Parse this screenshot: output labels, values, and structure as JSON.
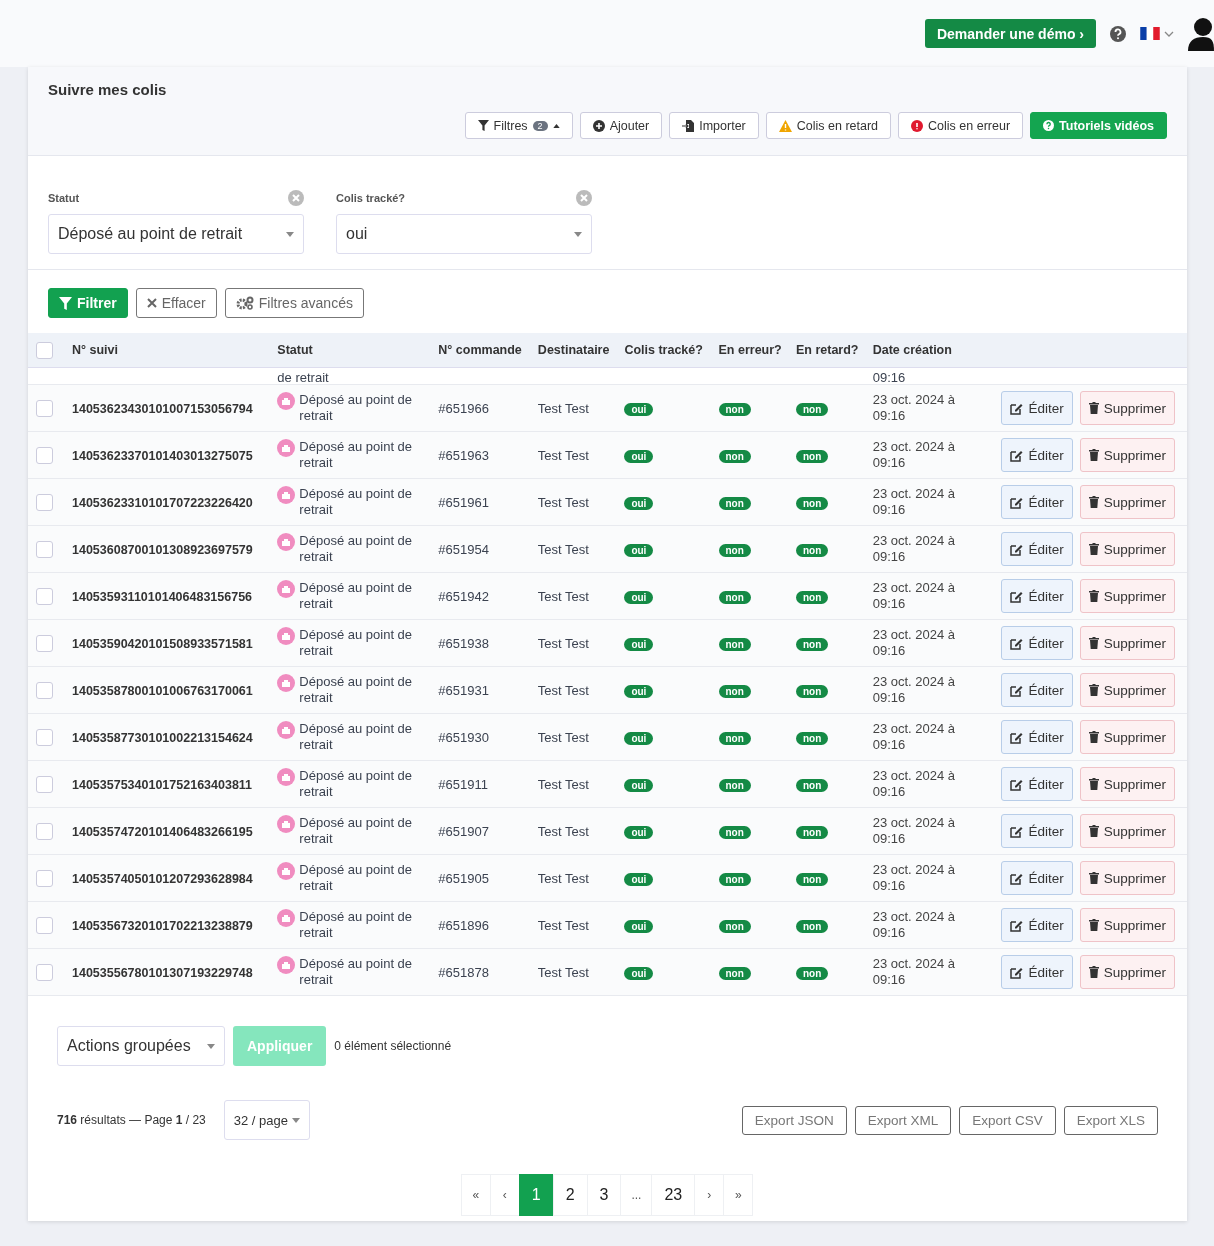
{
  "header": {
    "demo_button": "Demander une démo ›"
  },
  "page": {
    "title": "Suivre mes colis"
  },
  "toolbar": [
    {
      "kind": "filter",
      "label": "Filtres",
      "badge": "2"
    },
    {
      "kind": "add",
      "label": "Ajouter"
    },
    {
      "kind": "import",
      "label": "Importer"
    },
    {
      "kind": "warning",
      "label": "Colis en retard"
    },
    {
      "kind": "error",
      "label": "Colis en erreur"
    },
    {
      "kind": "video",
      "label": "Tutoriels vidéos"
    }
  ],
  "filters": [
    {
      "label": "Statut",
      "value": "Déposé au point de retrait"
    },
    {
      "label": "Colis tracké?",
      "value": "oui"
    }
  ],
  "filter_actions": [
    {
      "kind": "primary",
      "label": "Filtrer"
    },
    {
      "kind": "clear",
      "label": "Effacer"
    },
    {
      "kind": "advanced",
      "label": "Filtres avancés"
    }
  ],
  "table": {
    "columns": [
      "N° suivi",
      "Statut",
      "N° commande",
      "Destinataire",
      "Colis tracké?",
      "En erreur?",
      "En retard?",
      "Date création"
    ],
    "select_all_checked": false,
    "partial_row": {
      "status": "de retrait",
      "date": "09:16"
    },
    "rows": [
      {
        "tracking": "14053623430101007153056794",
        "status": "Déposé au point de retrait",
        "order": "#651966",
        "recipient": "Test Test",
        "tracked": "oui",
        "error": "non",
        "late": "non",
        "date": "23 oct. 2024 à 09:16",
        "edit": "Éditer",
        "delete": "Supprimer",
        "checked": false
      },
      {
        "tracking": "14053623370101403013275075",
        "status": "Déposé au point de retrait",
        "order": "#651963",
        "recipient": "Test Test",
        "tracked": "oui",
        "error": "non",
        "late": "non",
        "date": "23 oct. 2024 à 09:16",
        "edit": "Éditer",
        "delete": "Supprimer",
        "checked": false
      },
      {
        "tracking": "14053623310101707223226420",
        "status": "Déposé au point de retrait",
        "order": "#651961",
        "recipient": "Test Test",
        "tracked": "oui",
        "error": "non",
        "late": "non",
        "date": "23 oct. 2024 à 09:16",
        "edit": "Éditer",
        "delete": "Supprimer",
        "checked": false
      },
      {
        "tracking": "14053608700101308923697579",
        "status": "Déposé au point de retrait",
        "order": "#651954",
        "recipient": "Test Test",
        "tracked": "oui",
        "error": "non",
        "late": "non",
        "date": "23 oct. 2024 à 09:16",
        "edit": "Éditer",
        "delete": "Supprimer",
        "checked": false
      },
      {
        "tracking": "14053593110101406483156756",
        "status": "Déposé au point de retrait",
        "order": "#651942",
        "recipient": "Test Test",
        "tracked": "oui",
        "error": "non",
        "late": "non",
        "date": "23 oct. 2024 à 09:16",
        "edit": "Éditer",
        "delete": "Supprimer",
        "checked": false
      },
      {
        "tracking": "14053590420101508933571581",
        "status": "Déposé au point de retrait",
        "order": "#651938",
        "recipient": "Test Test",
        "tracked": "oui",
        "error": "non",
        "late": "non",
        "date": "23 oct. 2024 à 09:16",
        "edit": "Éditer",
        "delete": "Supprimer",
        "checked": false
      },
      {
        "tracking": "14053587800101006763170061",
        "status": "Déposé au point de retrait",
        "order": "#651931",
        "recipient": "Test Test",
        "tracked": "oui",
        "error": "non",
        "late": "non",
        "date": "23 oct. 2024 à 09:16",
        "edit": "Éditer",
        "delete": "Supprimer",
        "checked": false
      },
      {
        "tracking": "14053587730101002213154624",
        "status": "Déposé au point de retrait",
        "order": "#651930",
        "recipient": "Test Test",
        "tracked": "oui",
        "error": "non",
        "late": "non",
        "date": "23 oct. 2024 à 09:16",
        "edit": "Éditer",
        "delete": "Supprimer",
        "checked": false
      },
      {
        "tracking": "14053575340101752163403811",
        "status": "Déposé au point de retrait",
        "order": "#651911",
        "recipient": "Test Test",
        "tracked": "oui",
        "error": "non",
        "late": "non",
        "date": "23 oct. 2024 à 09:16",
        "edit": "Éditer",
        "delete": "Supprimer",
        "checked": false
      },
      {
        "tracking": "14053574720101406483266195",
        "status": "Déposé au point de retrait",
        "order": "#651907",
        "recipient": "Test Test",
        "tracked": "oui",
        "error": "non",
        "late": "non",
        "date": "23 oct. 2024 à 09:16",
        "edit": "Éditer",
        "delete": "Supprimer",
        "checked": false
      },
      {
        "tracking": "14053574050101207293628984",
        "status": "Déposé au point de retrait",
        "order": "#651905",
        "recipient": "Test Test",
        "tracked": "oui",
        "error": "non",
        "late": "non",
        "date": "23 oct. 2024 à 09:16",
        "edit": "Éditer",
        "delete": "Supprimer",
        "checked": false
      },
      {
        "tracking": "14053567320101702213238879",
        "status": "Déposé au point de retrait",
        "order": "#651896",
        "recipient": "Test Test",
        "tracked": "oui",
        "error": "non",
        "late": "non",
        "date": "23 oct. 2024 à 09:16",
        "edit": "Éditer",
        "delete": "Supprimer",
        "checked": false
      },
      {
        "tracking": "14053556780101307193229748",
        "status": "Déposé au point de retrait",
        "order": "#651878",
        "recipient": "Test Test",
        "tracked": "oui",
        "error": "non",
        "late": "non",
        "date": "23 oct. 2024 à 09:16",
        "edit": "Éditer",
        "delete": "Supprimer",
        "checked": false
      }
    ]
  },
  "bulk": {
    "select": "Actions groupées",
    "apply": "Appliquer",
    "apply_disabled": true,
    "selection": "0 élément sélectionné"
  },
  "summary": {
    "results": "**716** résultats — Page **1** / 23",
    "per_page": "32 / page"
  },
  "exports": [
    "Export JSON",
    "Export XML",
    "Export CSV",
    "Export XLS"
  ],
  "pagination": [
    {
      "label": "«",
      "selected": false
    },
    {
      "label": "‹",
      "selected": false
    },
    {
      "label": "1",
      "selected": true
    },
    {
      "label": "2",
      "selected": false
    },
    {
      "label": "3",
      "selected": false
    },
    {
      "label": "...",
      "selected": false
    },
    {
      "label": "23",
      "selected": false
    },
    {
      "label": "›",
      "selected": false
    },
    {
      "label": "»",
      "selected": false
    }
  ]
}
